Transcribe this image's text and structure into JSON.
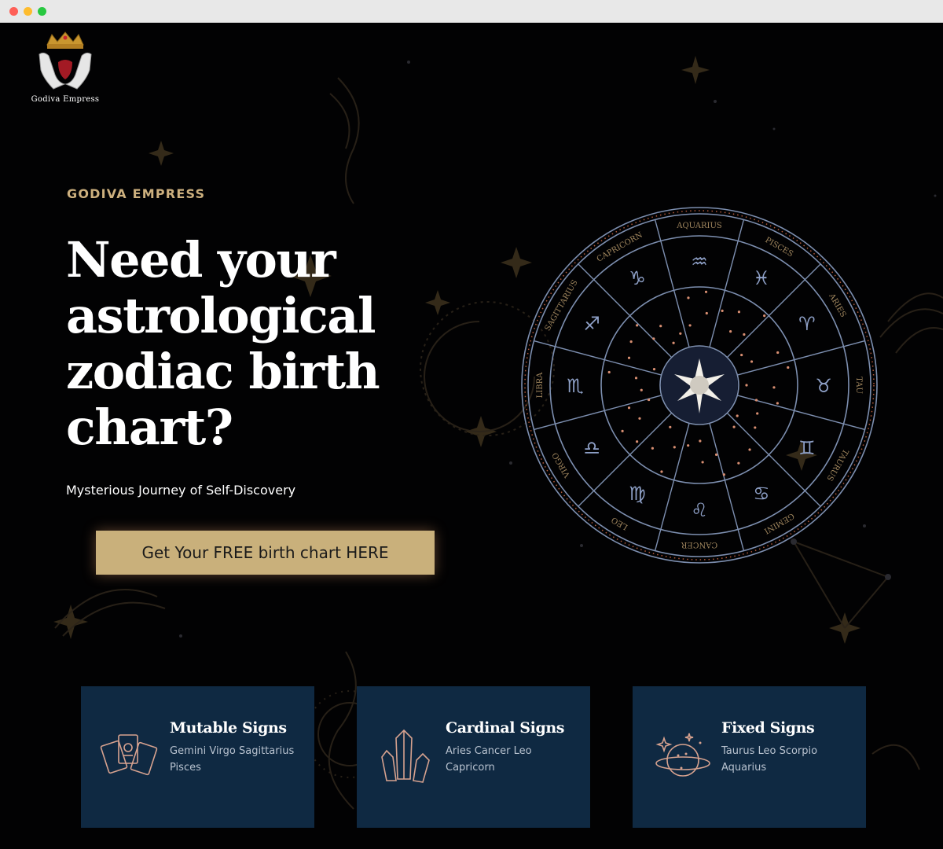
{
  "brand": {
    "logo_text": "Godiva Empress"
  },
  "hero": {
    "eyebrow": "GODIVA EMPRESS",
    "headline": "Need your astrological zodiac birth chart?",
    "subline": "Mysterious Journey of Self-Discovery",
    "cta_label": "Get Your FREE birth chart HERE"
  },
  "zodiac_wheel": {
    "signs": [
      "AQUARIUS",
      "PISCES",
      "ARIES",
      "TAURUS",
      "GEMINI",
      "CANCER",
      "LEO",
      "VIRGO",
      "LIBRA",
      "SAGITTARIUS",
      "CAPRICORN"
    ],
    "partial_label": "TAU",
    "glyphs": [
      "♒",
      "♓",
      "♈",
      "♉",
      "♊",
      "♋",
      "♌",
      "♍",
      "♎",
      "♏",
      "♐",
      "♑"
    ]
  },
  "cards": [
    {
      "title": "Mutable Signs",
      "desc": "Gemini Virgo Sagittarius Pisces",
      "icon": "tarot-cards-icon"
    },
    {
      "title": "Cardinal Signs",
      "desc": "Aries Cancer Leo Capricorn",
      "icon": "crystal-icon"
    },
    {
      "title": "Fixed Signs",
      "desc": "Taurus Leo Scorpio Aquarius",
      "icon": "planet-icon"
    }
  ],
  "colors": {
    "background": "#020203",
    "accent_gold": "#c9b07b",
    "eyebrow_gold": "#cdb07e",
    "card_navy": "#0f2942",
    "wheel_line": "#7d8fb0"
  }
}
